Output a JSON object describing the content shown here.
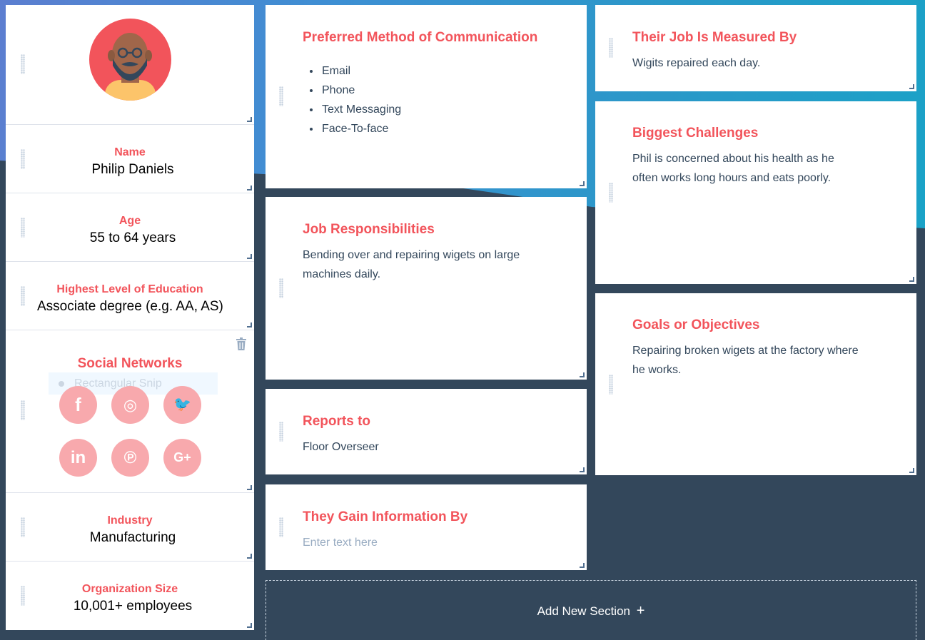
{
  "profile": {
    "name": {
      "label": "Name",
      "value": "Philip Daniels"
    },
    "age": {
      "label": "Age",
      "value": "55 to 64 years"
    },
    "education": {
      "label": "Highest Level of Education",
      "value": "Associate degree (e.g. AA, AS)"
    },
    "social": {
      "label": "Social Networks",
      "ghost_text": "Rectangular Snip",
      "networks": [
        "facebook",
        "instagram",
        "twitter",
        "linkedin",
        "pinterest",
        "google-plus"
      ],
      "glyphs": {
        "facebook": "f",
        "instagram": "◎",
        "twitter": "🐦",
        "linkedin": "in",
        "pinterest": "℗",
        "google-plus": "G+"
      }
    },
    "industry": {
      "label": "Industry",
      "value": "Manufacturing"
    },
    "org_size": {
      "label": "Organization Size",
      "value": "10,001+ employees"
    }
  },
  "sections": {
    "communication": {
      "title": "Preferred Method of Communication",
      "items": [
        "Email",
        "Phone",
        "Text Messaging",
        "Face-To-face"
      ]
    },
    "responsibilities": {
      "title": "Job Responsibilities",
      "text": "Bending over and repairing wigets on large machines daily."
    },
    "reports_to": {
      "title": "Reports to",
      "text": "Floor Overseer"
    },
    "gain_info": {
      "title": "They Gain Information By",
      "placeholder": "Enter text here"
    },
    "measured_by": {
      "title": "Their Job Is Measured By",
      "text": "Wigits repaired each day."
    },
    "challenges": {
      "title": "Biggest Challenges",
      "text": "Phil is concerned about his health as he often works long hours and eats poorly."
    },
    "goals": {
      "title": "Goals or Objectives",
      "text": "Repairing broken wigets at the factory where he works."
    }
  },
  "add_section": {
    "label": "Add New Section",
    "icon": "plus-icon",
    "glyph": "+"
  },
  "colors": {
    "accent": "#f2545b",
    "background": "#33475b",
    "social": "#f8a9ad"
  }
}
